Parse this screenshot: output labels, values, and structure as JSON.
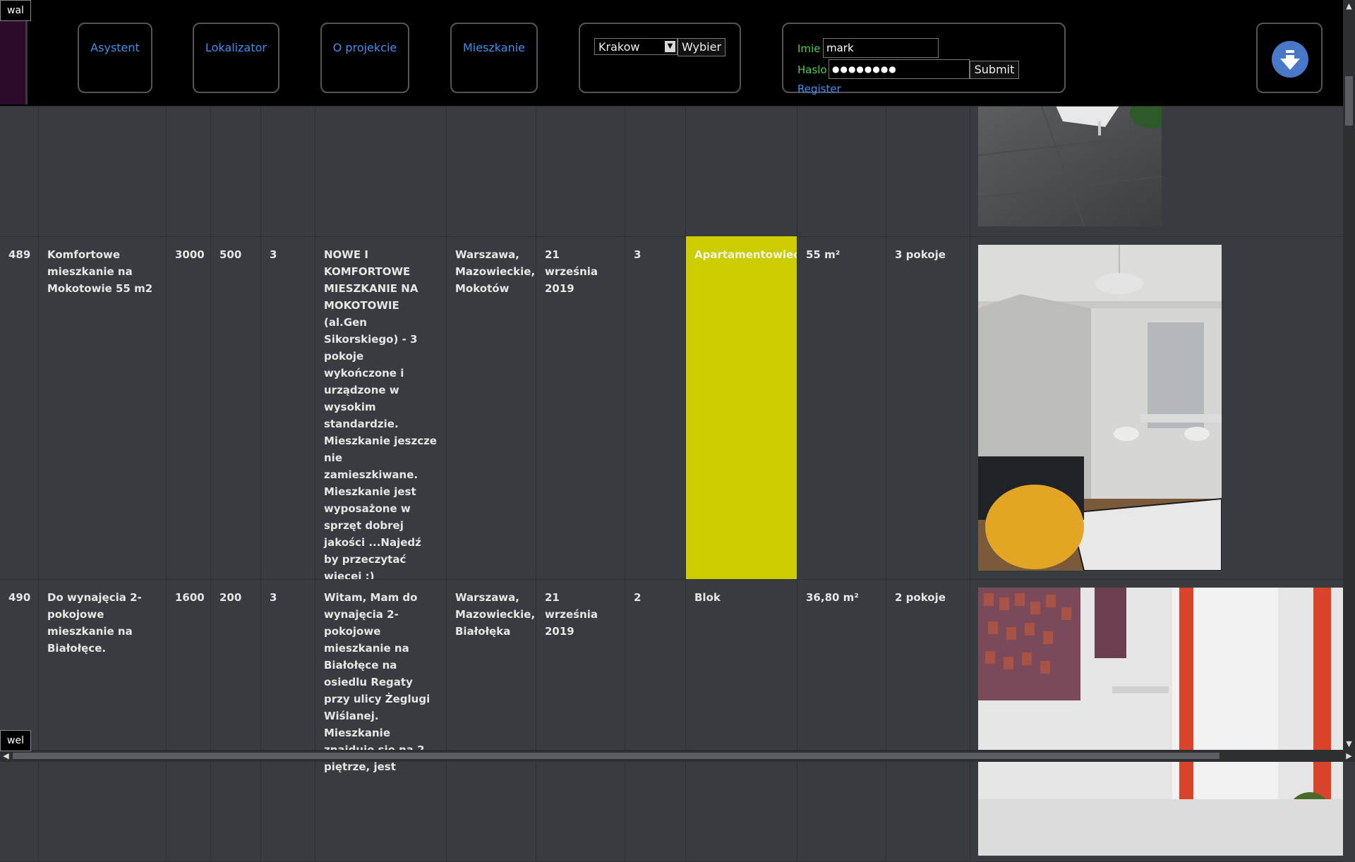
{
  "corner_tags": {
    "top": "wal",
    "bottom": "wel"
  },
  "nav": {
    "asystent": "Asystent",
    "lokalizator": "Lokalizator",
    "o_projekcie": "O projekcie",
    "mieszkanie": "Mieszkanie"
  },
  "city": {
    "selected": "Krakow",
    "button": "Wybier"
  },
  "login": {
    "name_label": "Imie",
    "name_value": "mark",
    "password_label": "Haslo",
    "password_value": "●●●●●●●●",
    "submit": "Submit",
    "register": "Register"
  },
  "download_icon": "download-arrow-icon",
  "listings": [
    {
      "id": "489",
      "title": "Komfortowe mieszkanie na Mokotowie 55 m2",
      "price": "3000",
      "deposit": "500",
      "floor": "3",
      "description": "NOWE I KOMFORTOWE MIESZKANIE NA MOKOTOWIE (al.Gen Sikorskiego) - 3 pokoje wykończone i urządzone w wysokim standardzie. Mieszkanie jeszcze nie zamieszkiwane. Mieszkanie jest wyposażone w sprzęt dobrej jakości ...Najedź by przeczytać więcej :)",
      "location": "Warszawa, Mazowieckie, Mokotów",
      "date": "21 września 2019",
      "rooms_num": "3",
      "building": "Apartamentowiec",
      "area": "55 m²",
      "rooms": "3 pokoje",
      "building_color": "#cccd00"
    },
    {
      "id": "490",
      "title": "Do wynajęcia 2-pokojowe mieszkanie na Białołęce.",
      "price": "1600",
      "deposit": "200",
      "floor": "3",
      "description": "Witam, Mam do wynajęcia 2-pokojowe mieszkanie na Białołęce na osiedlu Regaty przy ulicy Żeglugi Wiślanej. Mieszkanie znajduje się na 2 piętrze, jest",
      "location": "Warszawa, Mazowieckie, Białołęka",
      "date": "21 września 2019",
      "rooms_num": "2",
      "building": "Blok",
      "area": "36,80 m²",
      "rooms": "2 pokoje"
    }
  ],
  "colors": {
    "accent_link": "#3f8ff0",
    "login_label": "#48d24a",
    "highlight": "#cccd00"
  }
}
